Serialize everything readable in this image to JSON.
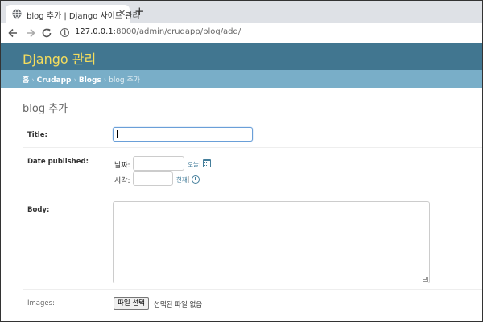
{
  "browser": {
    "tab_title": "blog 추가 | Django 사이트 관리",
    "tab_close": "✕",
    "new_tab": "+",
    "url_host": "127.0.0.1",
    "url_path": ":8000/admin/crudapp/blog/add/"
  },
  "header": {
    "branding": "Django 관리"
  },
  "breadcrumbs": {
    "home": "홈",
    "app": "Crudapp",
    "model": "Blogs",
    "current": "blog 추가",
    "separator": "›"
  },
  "page": {
    "title": "blog 추가"
  },
  "form": {
    "title_label": "Title:",
    "title_value": "",
    "date_label": "Date published:",
    "date_sub_label": "날짜:",
    "date_value": "",
    "today_link": "오늘",
    "time_sub_label": "시각:",
    "time_value": "",
    "now_link": "현재",
    "shortcut_sep": "|",
    "body_label": "Body:",
    "body_value": "",
    "images_label": "Images:",
    "file_button": "파일 선택",
    "file_status": "선택된 파일 없음"
  },
  "colors": {
    "header_bg": "#417690",
    "branding": "#f5dd5d",
    "breadcrumbs_bg": "#79aec8",
    "link": "#447e9b"
  }
}
